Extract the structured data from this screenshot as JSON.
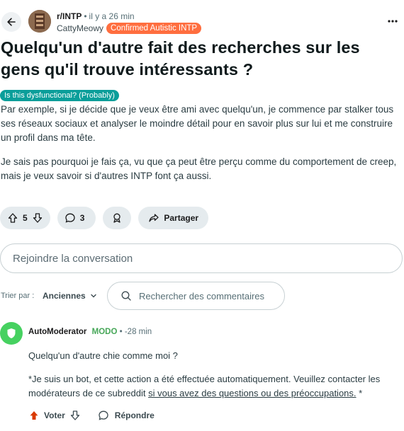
{
  "header": {
    "subreddit": "r/INTP",
    "time": "il y a 26 min",
    "author": "CattyMeowy",
    "author_flair": "Confirmed Autistic INTP"
  },
  "post": {
    "title": "Quelqu'un d'autre fait des recherches sur les gens qu'il trouve intéressants ?",
    "flair": "Is this dysfunctional? (Probably)",
    "paragraphs": [
      "Par exemple, si je décide que je veux être ami avec quelqu'un, je commence par stalker tous ses réseaux sociaux et analyser le moindre détail pour en savoir plus sur lui et me construire un profil dans ma tête.",
      "Je sais pas pourquoi je fais ça, vu que ça peut être perçu comme du comportement de creep, mais je veux savoir si d'autres INTP font ça aussi."
    ]
  },
  "actions": {
    "votes": "5",
    "comments": "3",
    "share_label": "Partager"
  },
  "join": {
    "placeholder": "Rejoindre la conversation"
  },
  "sort": {
    "label": "Trier par :",
    "value": "Anciennes",
    "search_placeholder": "Rechercher des commentaires"
  },
  "comment": {
    "author": "AutoModerator",
    "badge": "MODO",
    "time": "-28 min",
    "line1": "Quelqu'un d'autre chie comme moi ?",
    "line2_pre": "*Je suis un bot, et cette action a été effectuée automatiquement. Veuillez contacter les modérateurs de ce subreddit ",
    "line2_link": "si vous avez des questions ou des préoccupations.",
    "line2_post": " *",
    "vote_label": "Voter",
    "reply_label": "Répondre"
  },
  "colors": {
    "author_flair_bg": "#ff6e3f",
    "post_flair_bg": "#0a9e9a",
    "mod_green": "#46d160",
    "upvote_orange": "#d93a00"
  }
}
